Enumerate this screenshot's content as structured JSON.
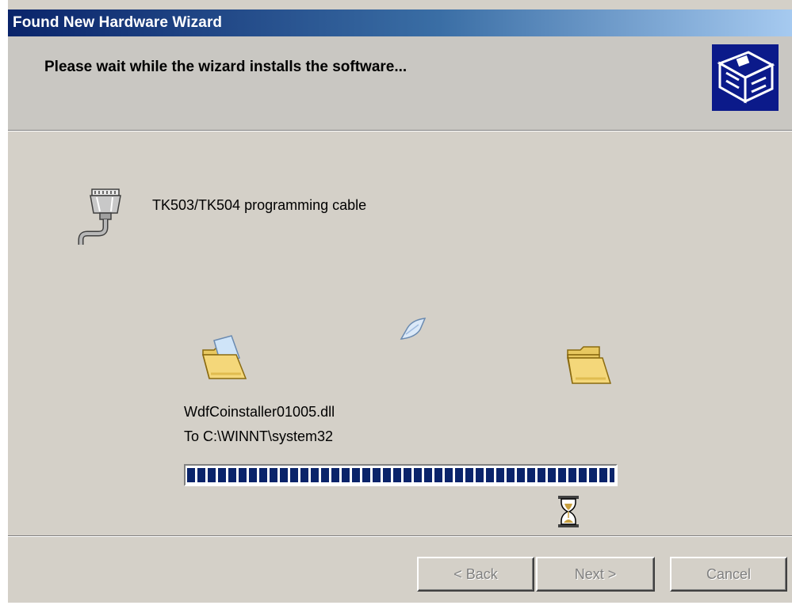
{
  "window": {
    "title": "Found New Hardware Wizard"
  },
  "header": {
    "title": "Please wait while the wizard installs the software...",
    "icon": "hardware-wizard-icon"
  },
  "device": {
    "icon": "serial-cable-icon",
    "name": "TK503/TK504 programming cable"
  },
  "copy_animation": {
    "source_icon": "open-folder-icon",
    "moving_icon": "flying-document-icon",
    "destination_icon": "folder-icon",
    "file_name": "WdfCoinstaller01005.dll",
    "destination": "To C:\\WINNT\\system32"
  },
  "progress": {
    "percent": 100,
    "color": "#0a246a"
  },
  "busy_icon": "hourglass-icon",
  "buttons": {
    "back": "< Back",
    "next": "Next >",
    "cancel": "Cancel"
  },
  "colors": {
    "title_gradient_start": "#0a246a",
    "title_gradient_end": "#a6caf0",
    "dialog_face": "#d4d0c8",
    "disabled_text": "#808080"
  }
}
